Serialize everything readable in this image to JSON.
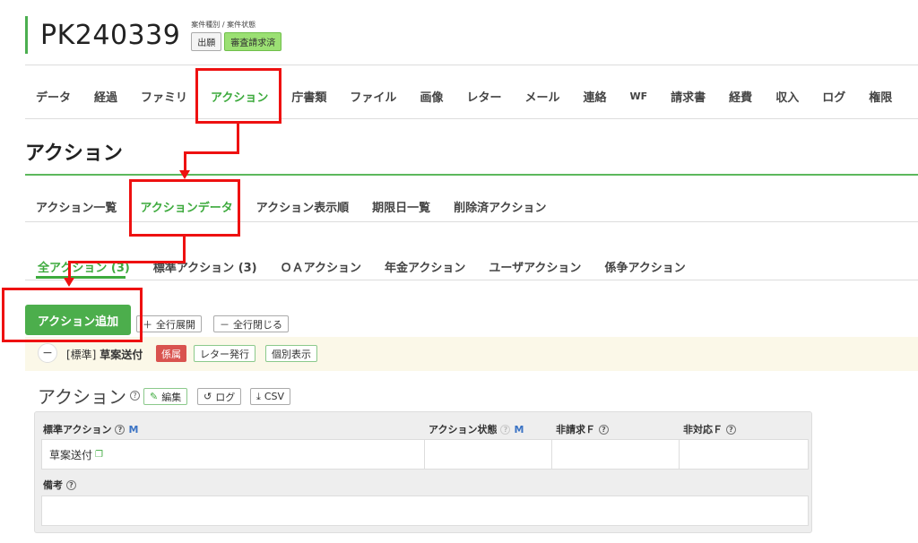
{
  "header": {
    "case_number": "PK240339",
    "meta_label": "案件種別 / 案件状態",
    "badge_type": "出願",
    "badge_status": "審査請求済"
  },
  "main_tabs": [
    "データ",
    "経過",
    "ファミリ",
    "アクション",
    "庁書類",
    "ファイル",
    "画像",
    "レター",
    "メール",
    "連絡",
    "WF",
    "請求書",
    "経費",
    "収入",
    "ログ",
    "権限"
  ],
  "main_tabs_active": "アクション",
  "section_title": "アクション",
  "sub_tabs": [
    "アクション一覧",
    "アクションデータ",
    "アクション表示順",
    "期限日一覧",
    "削除済アクション"
  ],
  "sub_tabs_active": "アクションデータ",
  "filter_tabs": [
    "全アクション (3)",
    "標準アクション (3)",
    "ＯＡアクション",
    "年金アクション",
    "ユーザアクション",
    "係争アクション"
  ],
  "toolbar": {
    "add_label": "アクション追加",
    "expand_all": "全行展開",
    "collapse_all": "全行閉じる"
  },
  "item": {
    "category": "[標準]",
    "name": "草案送付",
    "tag": "係属",
    "letter_button": "レター発行",
    "detail_button": "個別表示"
  },
  "panel": {
    "title": "アクション",
    "edit_button": "編集",
    "log_button": "ログ",
    "csv_button": "CSV"
  },
  "table": {
    "headers": {
      "standard_action": "標準アクション",
      "action_status": "アクション状態",
      "non_billing": "非請求Ｆ",
      "non_response": "非対応Ｆ",
      "m_marker": "M"
    },
    "row": {
      "standard_action": "草案送付",
      "action_status": "",
      "non_billing": "",
      "non_response": ""
    },
    "remarks_label": "備考",
    "remarks_value": ""
  },
  "colors": {
    "accent_green": "#3daa3d",
    "button_green": "#4cae4c",
    "annotation_red": "#e11111",
    "tag_red": "#d9534f"
  }
}
